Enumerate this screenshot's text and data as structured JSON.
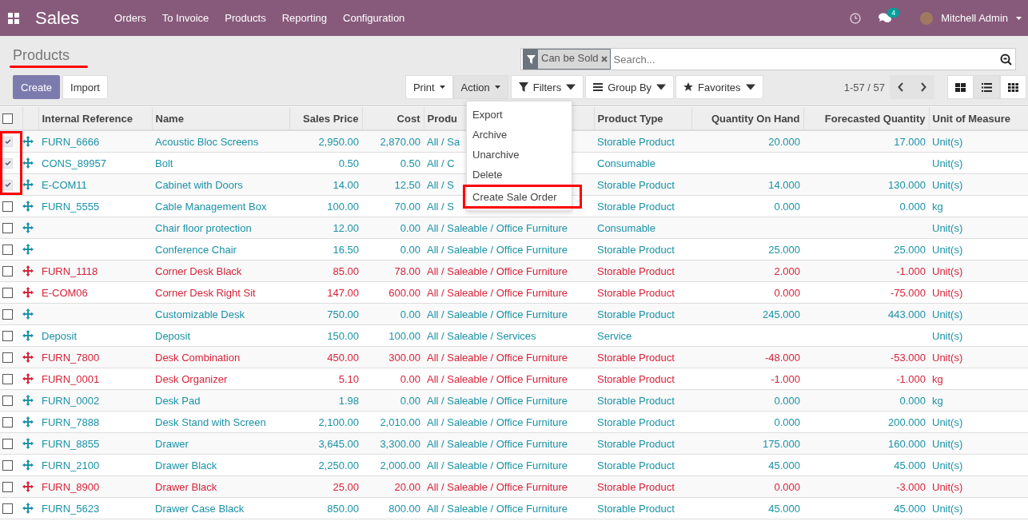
{
  "navbar": {
    "app": "Sales",
    "menu": [
      "Orders",
      "To Invoice",
      "Products",
      "Reporting",
      "Configuration"
    ],
    "message_count": "4",
    "user": "Mitchell Admin"
  },
  "breadcrumb": {
    "title": "Products",
    "underlined": true
  },
  "buttons": [
    {
      "label": "Create",
      "kind": "primary"
    },
    {
      "label": "Import",
      "kind": "secondary"
    }
  ],
  "search": {
    "facet": "Can be Sold",
    "placeholder": "Search..."
  },
  "dropdowns": [
    {
      "label": "Print",
      "open": false
    },
    {
      "label": "Action",
      "open": true
    }
  ],
  "search_options": [
    {
      "label": "Filters",
      "kind": "filter"
    },
    {
      "label": "Group By",
      "kind": "group"
    },
    {
      "label": "Favorites",
      "kind": "star"
    }
  ],
  "pager": "1-57 / 57",
  "views": [
    {
      "kind": "kanban",
      "selected": false
    },
    {
      "kind": "list",
      "selected": true
    },
    {
      "kind": "grid",
      "selected": false
    }
  ],
  "action_menu": [
    {
      "label": "Export",
      "highlighted": false
    },
    {
      "label": "Archive",
      "highlighted": false
    },
    {
      "label": "Unarchive",
      "highlighted": false
    },
    {
      "label": "Delete",
      "highlighted": false
    },
    {
      "label": "Create Sale Order",
      "highlighted": true
    }
  ],
  "table": {
    "checkbox_annotation": true,
    "select_all_checked": false,
    "columns": [
      "Internal Reference",
      "Name",
      "Sales Price",
      "Cost",
      "Produ",
      "Product Type",
      "Quantity On Hand",
      "Forecasted Quantity",
      "Unit of Measure"
    ],
    "rows": [
      {
        "checked": true,
        "danger": false,
        "ref": "FURN_6666",
        "name": "Acoustic Bloc Screens",
        "price": "2,950.00",
        "cost": "2,870.00",
        "category": "All / Sa",
        "type": "Storable Product",
        "on_hand": "20.000",
        "forecast": "17.000",
        "uom": "Unit(s)"
      },
      {
        "checked": true,
        "danger": false,
        "ref": "CONS_89957",
        "name": "Bolt",
        "price": "0.50",
        "cost": "0.50",
        "category": "All / C",
        "type": "Consumable",
        "uom": "Unit(s)"
      },
      {
        "checked": true,
        "danger": false,
        "ref": "E-COM11",
        "name": "Cabinet with Doors",
        "price": "14.00",
        "cost": "12.50",
        "category": "All / S",
        "type": "Storable Product",
        "on_hand": "14.000",
        "forecast": "130.000",
        "uom": "Unit(s)"
      },
      {
        "checked": false,
        "danger": false,
        "ref": "FURN_5555",
        "name": "Cable Management Box",
        "price": "100.00",
        "cost": "70.00",
        "category": "All / S",
        "type": "Storable Product",
        "on_hand": "0.000",
        "forecast": "0.000",
        "uom": "kg"
      },
      {
        "checked": false,
        "danger": false,
        "name": "Chair floor protection",
        "price": "12.00",
        "cost": "0.00",
        "category": "All / Saleable / Office Furniture",
        "type": "Consumable",
        "uom": "Unit(s)"
      },
      {
        "checked": false,
        "danger": false,
        "name": "Conference Chair",
        "price": "16.50",
        "cost": "0.00",
        "category": "All / Saleable / Office Furniture",
        "type": "Storable Product",
        "on_hand": "25.000",
        "forecast": "25.000",
        "uom": "Unit(s)"
      },
      {
        "checked": false,
        "danger": true,
        "ref": "FURN_1118",
        "name": "Corner Desk Black",
        "price": "85.00",
        "cost": "78.00",
        "category": "All / Saleable / Office Furniture",
        "type": "Storable Product",
        "on_hand": "2.000",
        "forecast": "-1.000",
        "uom": "Unit(s)"
      },
      {
        "checked": false,
        "danger": true,
        "ref": "E-COM06",
        "name": "Corner Desk Right Sit",
        "price": "147.00",
        "cost": "600.00",
        "category": "All / Saleable / Office Furniture",
        "type": "Storable Product",
        "on_hand": "0.000",
        "forecast": "-75.000",
        "uom": "Unit(s)"
      },
      {
        "checked": false,
        "danger": false,
        "name": "Customizable Desk",
        "price": "750.00",
        "cost": "0.00",
        "category": "All / Saleable / Office Furniture",
        "type": "Storable Product",
        "on_hand": "245.000",
        "forecast": "443.000",
        "uom": "Unit(s)"
      },
      {
        "checked": false,
        "danger": false,
        "ref": "Deposit",
        "name": "Deposit",
        "price": "150.00",
        "cost": "100.00",
        "category": "All / Saleable / Services",
        "type": "Service",
        "uom": "Unit(s)"
      },
      {
        "checked": false,
        "danger": true,
        "ref": "FURN_7800",
        "name": "Desk Combination",
        "price": "450.00",
        "cost": "300.00",
        "category": "All / Saleable / Office Furniture",
        "type": "Storable Product",
        "on_hand": "-48.000",
        "forecast": "-53.000",
        "uom": "Unit(s)"
      },
      {
        "checked": false,
        "danger": true,
        "ref": "FURN_0001",
        "name": "Desk Organizer",
        "price": "5.10",
        "cost": "0.00",
        "category": "All / Saleable / Office Furniture",
        "type": "Storable Product",
        "on_hand": "-1.000",
        "forecast": "-1.000",
        "uom": "kg"
      },
      {
        "checked": false,
        "danger": false,
        "ref": "FURN_0002",
        "name": "Desk Pad",
        "price": "1.98",
        "cost": "0.00",
        "category": "All / Saleable / Office Furniture",
        "type": "Storable Product",
        "on_hand": "0.000",
        "forecast": "0.000",
        "uom": "kg"
      },
      {
        "checked": false,
        "danger": false,
        "ref": "FURN_7888",
        "name": "Desk Stand with Screen",
        "price": "2,100.00",
        "cost": "2,010.00",
        "category": "All / Saleable / Office Furniture",
        "type": "Storable Product",
        "on_hand": "0.000",
        "forecast": "200.000",
        "uom": "Unit(s)"
      },
      {
        "checked": false,
        "danger": false,
        "ref": "FURN_8855",
        "name": "Drawer",
        "price": "3,645.00",
        "cost": "3,300.00",
        "category": "All / Saleable / Office Furniture",
        "type": "Storable Product",
        "on_hand": "175.000",
        "forecast": "160.000",
        "uom": "Unit(s)"
      },
      {
        "checked": false,
        "danger": false,
        "ref": "FURN_2100",
        "name": "Drawer Black",
        "price": "2,250.00",
        "cost": "2,000.00",
        "category": "All / Saleable / Office Furniture",
        "type": "Storable Product",
        "on_hand": "45.000",
        "forecast": "45.000",
        "uom": "Unit(s)"
      },
      {
        "checked": false,
        "danger": true,
        "ref": "FURN_8900",
        "name": "Drawer Black",
        "price": "25.00",
        "cost": "20.00",
        "category": "All / Saleable / Office Furniture",
        "type": "Storable Product",
        "on_hand": "0.000",
        "forecast": "-3.000",
        "uom": "Unit(s)"
      },
      {
        "checked": false,
        "danger": false,
        "ref": "FURN_5623",
        "name": "Drawer Case Black",
        "price": "850.00",
        "cost": "800.00",
        "category": "All / Saleable / Office Furniture",
        "type": "Storable Product",
        "on_hand": "45.000",
        "forecast": "45.000",
        "uom": "Unit(s)"
      }
    ]
  }
}
